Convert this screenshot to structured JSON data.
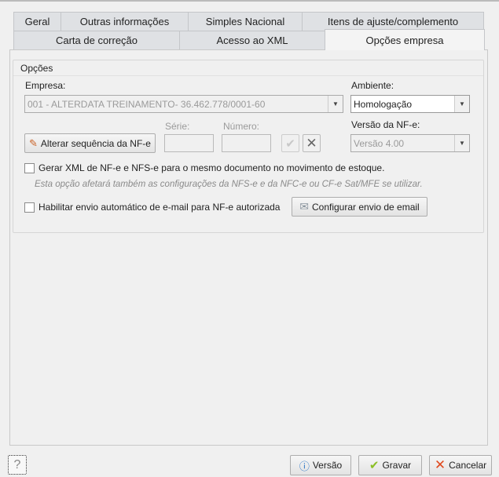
{
  "tabs_row1": [
    "Geral",
    "Outras informações",
    "Simples Nacional",
    "Itens de ajuste/complemento"
  ],
  "tabs_row2": [
    "Carta de correção",
    "Acesso ao XML",
    "Opções empresa"
  ],
  "group_title": "Opções",
  "empresa": {
    "label": "Empresa:",
    "value": "001 - ALTERDATA TREINAMENTO- 36.462.778/0001-60"
  },
  "ambiente": {
    "label": "Ambiente:",
    "value": "Homologação"
  },
  "alterar_button": "Alterar sequência da NF-e",
  "serie": {
    "label": "Série:",
    "value": ""
  },
  "numero": {
    "label": "Número:",
    "value": ""
  },
  "versao_nfe": {
    "label": "Versão da NF-e:",
    "value": "Versão 4.00"
  },
  "gerar_xml": {
    "label": "Gerar XML de NF-e e NFS-e para o mesmo documento no movimento de estoque.",
    "checked": false
  },
  "note": "Esta opção afetará também as configurações da NFS-e e da NFC-e ou CF-e Sat/MFE se utilizar.",
  "habilitar_email": {
    "label": "Habilitar envio automático de e-mail para NF-e autorizada",
    "checked": false
  },
  "configurar_email_button": "Configurar envio de email",
  "footer": {
    "help": "?",
    "versao": "Versão",
    "gravar": "Gravar",
    "cancelar": "Cancelar"
  }
}
